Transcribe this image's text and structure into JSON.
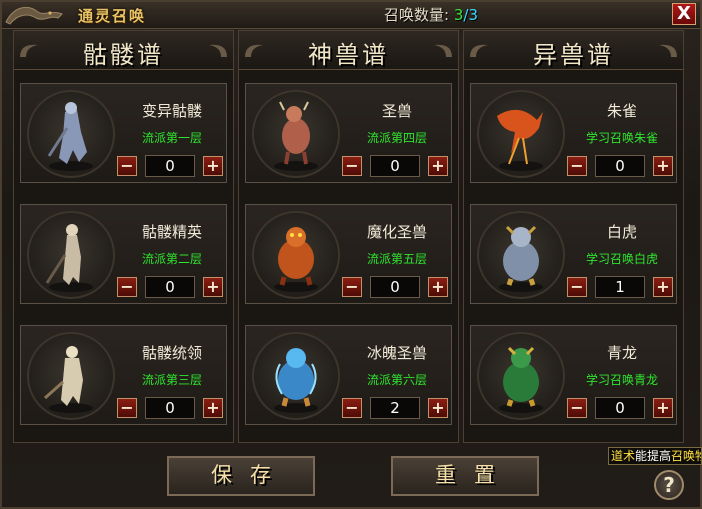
{
  "window": {
    "title": "通灵召唤",
    "close_label": "X"
  },
  "summon": {
    "label": "召唤数量:",
    "current": "3",
    "separator": "/",
    "max": "3"
  },
  "columns": [
    {
      "header": "骷髅谱",
      "cards": [
        {
          "name": "变异骷髅",
          "school": "流派第一层",
          "value": "0",
          "icon": "mutant-skeleton-portrait-icon"
        },
        {
          "name": "骷髅精英",
          "school": "流派第二层",
          "value": "0",
          "icon": "elite-skeleton-portrait-icon"
        },
        {
          "name": "骷髅统领",
          "school": "流派第三层",
          "value": "0",
          "icon": "skeleton-commander-portrait-icon"
        }
      ]
    },
    {
      "header": "神兽谱",
      "cards": [
        {
          "name": "圣兽",
          "school": "流派第四层",
          "value": "0",
          "icon": "divine-beast-portrait-icon"
        },
        {
          "name": "魔化圣兽",
          "school": "流派第五层",
          "value": "0",
          "icon": "demonized-beast-portrait-icon"
        },
        {
          "name": "冰魄圣兽",
          "school": "流派第六层",
          "value": "2",
          "icon": "ice-beast-portrait-icon"
        }
      ]
    },
    {
      "header": "异兽谱",
      "cards": [
        {
          "name": "朱雀",
          "school": "学习召唤朱雀",
          "value": "0",
          "icon": "vermilion-bird-portrait-icon"
        },
        {
          "name": "白虎",
          "school": "学习召唤白虎",
          "value": "1",
          "icon": "white-tiger-portrait-icon"
        },
        {
          "name": "青龙",
          "school": "学习召唤青龙",
          "value": "0",
          "icon": "azure-dragon-portrait-icon"
        }
      ]
    }
  ],
  "controls": {
    "minus": "−",
    "plus": "+"
  },
  "actions": {
    "save": "保存",
    "reset": "重置"
  },
  "tooltip": {
    "prefix": "道术",
    "mid": "能提高",
    "highlight": "召唤物"
  },
  "help": {
    "label": "?"
  },
  "colors": {
    "school_text": "#2ee62e",
    "count_current": "#38e038",
    "count_max": "#38d8ff",
    "title": "#e8c464"
  }
}
